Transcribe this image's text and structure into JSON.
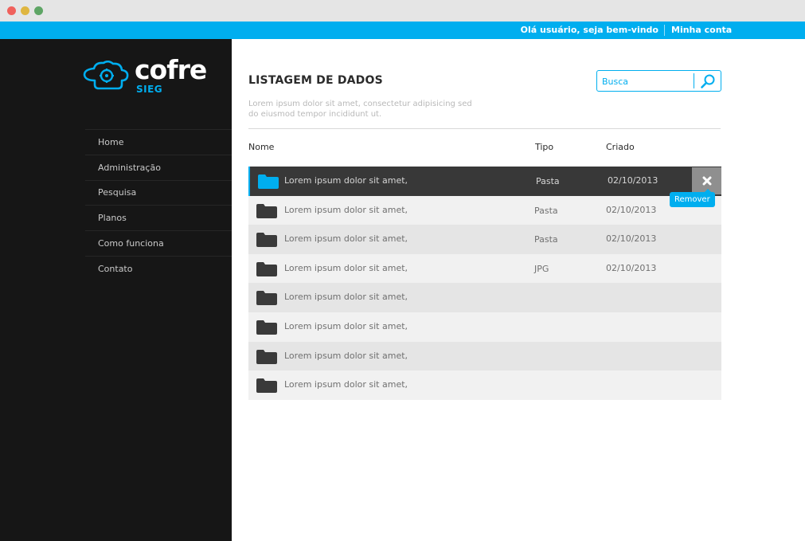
{
  "topbar": {
    "greeting": "Olá usuário, seja bem-vindo",
    "account_link": "Minha conta"
  },
  "logo": {
    "word": "cofre",
    "sub": "SIEG"
  },
  "nav": {
    "items": [
      {
        "label": "Home"
      },
      {
        "label": "Administração"
      },
      {
        "label": "Pesquisa"
      },
      {
        "label": "Planos"
      },
      {
        "label": "Como funciona"
      },
      {
        "label": "Contato"
      }
    ]
  },
  "main": {
    "title": "LISTAGEM DE DADOS",
    "description": "Lorem ipsum dolor sit amet, consectetur adipisicing sed do eiusmod tempor incididunt ut.",
    "search": {
      "placeholder": "Busca"
    },
    "table": {
      "headers": {
        "name": "Nome",
        "type": "Tipo",
        "created": "Criado"
      },
      "rows": [
        {
          "name": "Lorem ipsum dolor sit amet,",
          "type": "Pasta",
          "created": "02/10/2013",
          "selected": true
        },
        {
          "name": "Lorem ipsum dolor sit amet,",
          "type": "Pasta",
          "created": "02/10/2013"
        },
        {
          "name": "Lorem ipsum dolor sit amet,",
          "type": "Pasta",
          "created": "02/10/2013"
        },
        {
          "name": "Lorem ipsum dolor sit amet,",
          "type": "JPG",
          "created": "02/10/2013"
        },
        {
          "name": "Lorem ipsum dolor sit amet,",
          "type": "",
          "created": ""
        },
        {
          "name": "Lorem ipsum dolor sit amet,",
          "type": "",
          "created": ""
        },
        {
          "name": "Lorem ipsum dolor sit amet,",
          "type": "",
          "created": ""
        },
        {
          "name": "Lorem ipsum dolor sit amet,",
          "type": "",
          "created": ""
        }
      ],
      "remove_tooltip": "Remover"
    }
  },
  "icons": {
    "folder": "folder-icon",
    "search": "search-icon",
    "close": "close-icon",
    "logo": "cloud-vault-icon"
  },
  "colors": {
    "accent": "#00aeef",
    "sidebar": "#161616",
    "selected_row": "#383838",
    "row_light": "#f1f1f1",
    "row_dark": "#e5e5e5"
  }
}
